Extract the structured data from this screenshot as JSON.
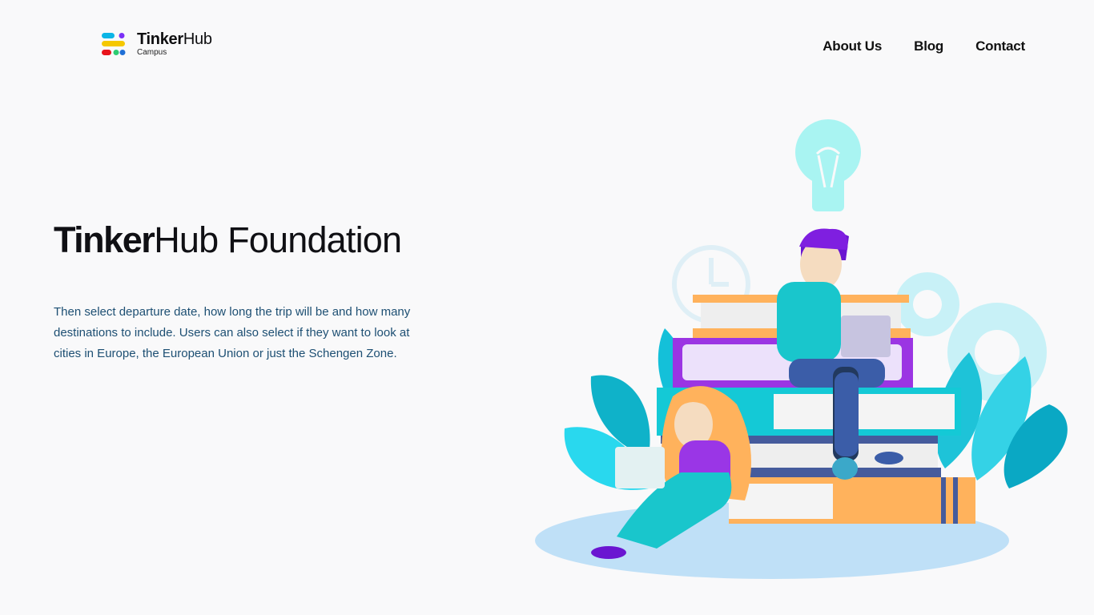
{
  "brand": {
    "name_bold": "Tinker",
    "name_regular": "Hub",
    "subtitle": "Campus",
    "dot_colors": [
      "#0bb5e6",
      "#7b2ff7",
      "#f5c800",
      "#e8141c",
      "#2ecc71",
      "#1f6fd6"
    ]
  },
  "nav": {
    "items": [
      {
        "label": "About Us"
      },
      {
        "label": "Blog"
      },
      {
        "label": "Contact"
      }
    ]
  },
  "hero": {
    "title_bold": "Tinker",
    "title_regular": "Hub Foundation",
    "description": "Then select departure date, how long the trip will be and how many destinations to include. Users can also select if they want to look at cities in Europe, the European Union or just the Schengen Zone."
  },
  "colors": {
    "background": "#f9f9fa",
    "text_primary": "#101014",
    "text_body": "#1d4f73",
    "accent_cyan": "#14c9d6",
    "accent_purple": "#8a2be2",
    "accent_orange": "#ffb25c"
  },
  "illustration": {
    "icon": "students-reading-books-illustration"
  }
}
